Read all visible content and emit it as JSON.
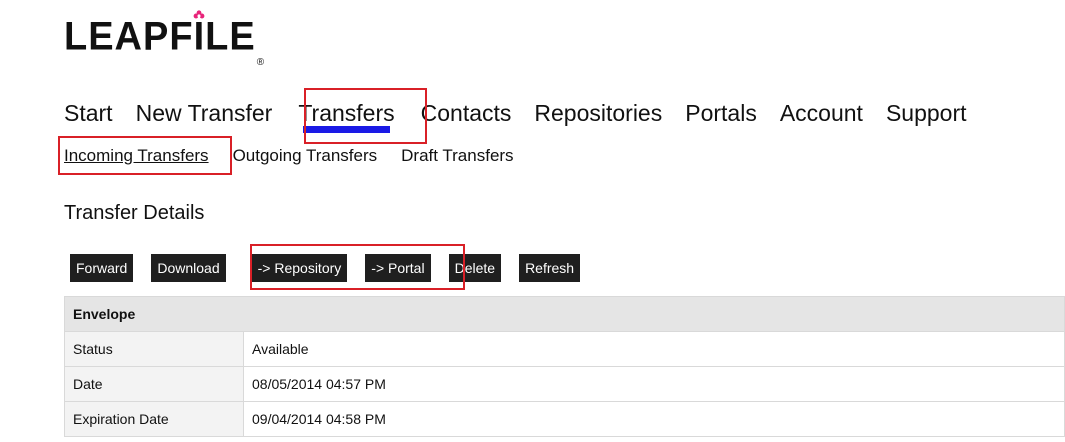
{
  "logo": {
    "text_before": "LEAPF",
    "letter_i": "I",
    "text_after": "LE",
    "registered": "®",
    "accent_color": "#e8247a"
  },
  "main_nav": [
    {
      "label": "Start",
      "active": false
    },
    {
      "label": "New Transfer",
      "active": false
    },
    {
      "label": "Transfers",
      "active": true
    },
    {
      "label": "Contacts",
      "active": false
    },
    {
      "label": "Repositories",
      "active": false
    },
    {
      "label": "Portals",
      "active": false
    },
    {
      "label": "Account",
      "active": false
    },
    {
      "label": "Support",
      "active": false
    }
  ],
  "sub_nav": [
    {
      "label": "Incoming Transfers",
      "active": true
    },
    {
      "label": "Outgoing Transfers",
      "active": false
    },
    {
      "label": "Draft Transfers",
      "active": false
    }
  ],
  "section_title": "Transfer Details",
  "toolbar": {
    "forward": "Forward",
    "download": "Download",
    "to_repository": "-> Repository",
    "to_portal": "-> Portal",
    "delete": "Delete",
    "refresh": "Refresh"
  },
  "envelope": {
    "header": "Envelope",
    "rows": [
      {
        "label": "Status",
        "value": "Available"
      },
      {
        "label": "Date",
        "value": "08/05/2014 04:57 PM"
      },
      {
        "label": "Expiration Date",
        "value": "09/04/2014 04:58 PM"
      }
    ]
  },
  "colors": {
    "highlight_box": "#d92027",
    "active_underline": "#1a1ae6",
    "button_bg": "#1f1f1f"
  }
}
